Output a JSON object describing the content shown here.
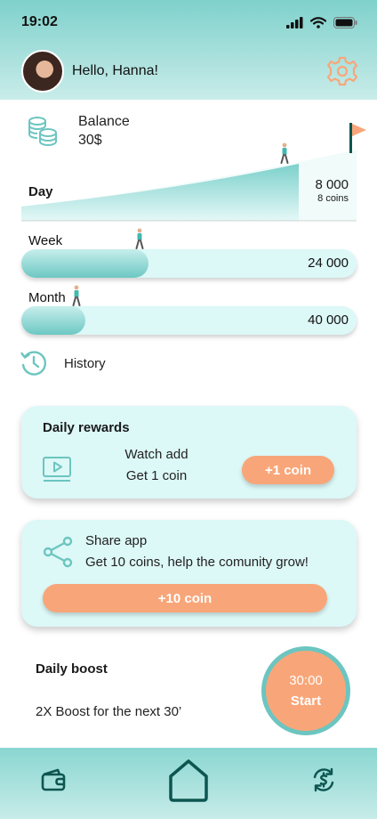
{
  "status_bar": {
    "time": "19:02",
    "icons": [
      "signal-icon",
      "wifi-icon",
      "battery-icon"
    ]
  },
  "header": {
    "greeting": "Hello, Hanna!",
    "settings_icon": "gear-icon"
  },
  "balance": {
    "label": "Balance",
    "value": "30$",
    "icon": "coins-icon"
  },
  "day": {
    "label": "Day",
    "value": "8 000",
    "coins": "8 coins",
    "goal_icon": "flag-icon"
  },
  "week": {
    "label": "Week",
    "value": "24 000",
    "progress": 0.38
  },
  "month": {
    "label": "Month",
    "value": "40 000",
    "progress": 0.19
  },
  "history": {
    "label": "History",
    "icon": "history-icon"
  },
  "daily_rewards": {
    "title": "Daily rewards",
    "line1": "Watch add",
    "line2": "Get 1 coin",
    "button": "+1 coin",
    "icon": "video-icon"
  },
  "share": {
    "title": "Share app",
    "subtitle": "Get 10 coins, help the comunity grow!",
    "button": "+10 coin",
    "icon": "share-icon"
  },
  "boost": {
    "title": "Daily boost",
    "subtitle": "2X Boost for the next 30’",
    "timer": "30:00",
    "start": "Start"
  },
  "bottom_nav": {
    "items": [
      "wallet-icon",
      "home-icon",
      "exchange-icon"
    ]
  },
  "colors": {
    "teal": "#6cc5c0",
    "light_teal": "#dcf8f7",
    "orange": "#f8a679"
  }
}
